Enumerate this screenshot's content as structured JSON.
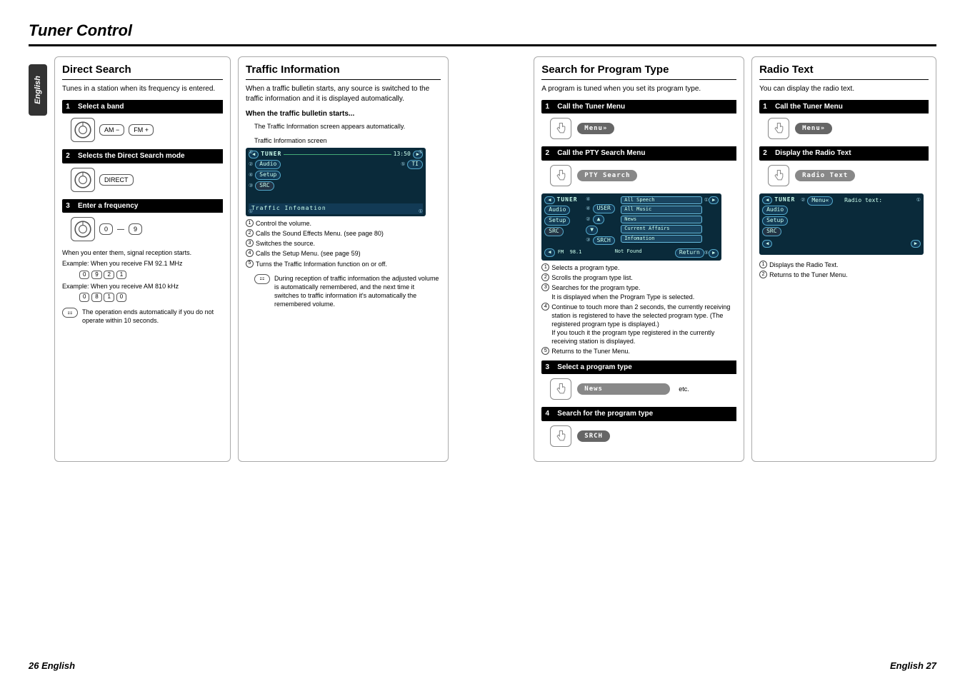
{
  "chapter_title": "Tuner Control",
  "side_tab": "English",
  "footer_left": "26 English",
  "footer_right": "English 27",
  "col1": {
    "title": "Direct Search",
    "intro": "Tunes in a station when its frequency is entered.",
    "step1": "Select a band",
    "btn_am": "AM −",
    "btn_fm": "FM +",
    "step2": "Selects the Direct Search mode",
    "btn_direct": "DIRECT",
    "step3": "Enter a frequency",
    "btn_0": "0",
    "dash": "—",
    "btn_9": "9",
    "body1": "When you enter them, signal reception starts.",
    "ex1": "Example: When you receive FM 92.1 MHz",
    "seq1": [
      "0",
      "9",
      "2",
      "1"
    ],
    "ex2": "Example: When you receive AM 810 kHz",
    "seq2": [
      "0",
      "8",
      "1",
      "0"
    ],
    "note": "The operation ends automatically if you do not operate within 10 seconds."
  },
  "col2": {
    "title": "Traffic Information",
    "intro": "When a traffic bulletin starts, any source is switched to the traffic information and it is displayed automatically.",
    "subhead": "When the traffic bulletin starts...",
    "line1": "The Traffic Information screen appears automatically.",
    "caption": "Traffic Information screen",
    "screen": {
      "tuner": "TUNER",
      "time": "13:50",
      "audio": "Audio",
      "setup": "Setup",
      "src": "SRC",
      "ti": "TI",
      "banner": "Traffic Infomation"
    },
    "list": [
      "Control the volume.",
      "Calls the Sound Effects Menu. (see page 80)",
      "Switches the source.",
      "Calls the Setup Menu. (see page 59)",
      "Turns the Traffic Information function on or off."
    ],
    "note": "During reception of traffic information the adjusted volume is automatically remembered, and the next time it switches to traffic information it's automatically the remembered volume."
  },
  "col3": {
    "title": "Search for Program Type",
    "intro": "A program is tuned when you set its program type.",
    "step1": "Call the Tuner Menu",
    "menu_btn": "Menu»",
    "step2": "Call the PTY Search Menu",
    "pty_btn": "PTY Search",
    "screen": {
      "tuner": "TUNER",
      "audio": "Audio",
      "setup": "Setup",
      "src": "SRC",
      "user": "USER",
      "up": "▲",
      "down": "▼",
      "srch": "SRCH",
      "items": [
        "All Speech",
        "All Music",
        "News",
        "Current Affairs",
        "Infomation"
      ],
      "band": "FM",
      "freq": "98.1",
      "status": "Not Found",
      "return": "Return"
    },
    "list": [
      "Selects a program type.",
      "Scrolls the program type list.",
      "Searches for the program type.\nIt is displayed when the Program Type is selected.",
      "Continue to touch more than 2 seconds, the currently receiving station is registered to have the selected program type. (The registered program type is displayed.)\nIf you touch it the program type registered in the currently receiving station is displayed.",
      "Returns to the Tuner Menu."
    ],
    "step3": "Select a program type",
    "news_btn": "News",
    "etc": "etc.",
    "step4": "Search for the program type",
    "srch_btn": "SRCH"
  },
  "col4": {
    "title": "Radio Text",
    "intro": "You can display the radio text.",
    "step1": "Call the Tuner Menu",
    "menu_btn": "Menu»",
    "step2": "Display the Radio Text",
    "rt_btn": "Radio Text",
    "screen": {
      "tuner": "TUNER",
      "audio": "Audio",
      "setup": "Setup",
      "src": "SRC",
      "menu": "Menu«",
      "label": "Radio text:"
    },
    "list": [
      "Displays the Radio Text.",
      "Returns to the Tuner Menu."
    ]
  }
}
